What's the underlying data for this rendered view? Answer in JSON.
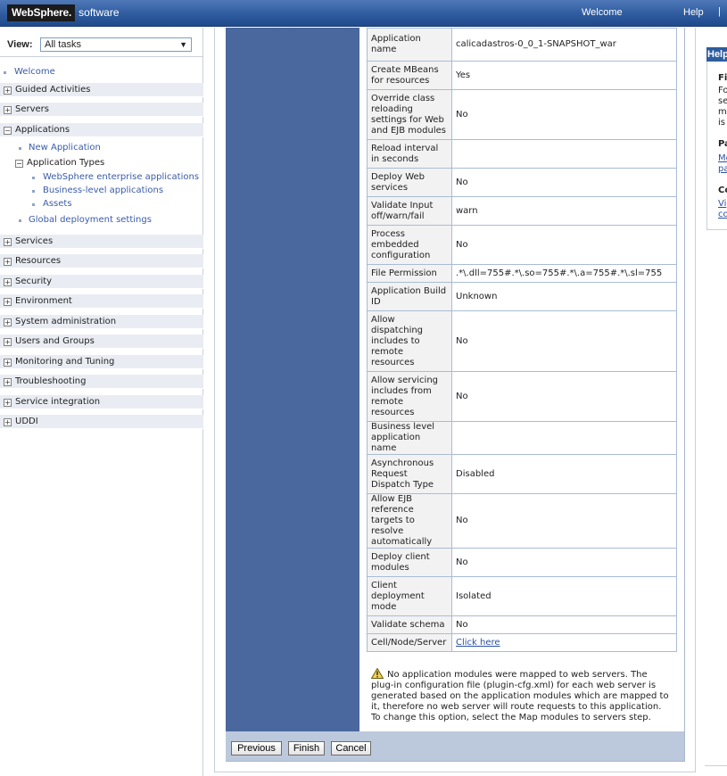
{
  "banner": {
    "brand_ws": "WebSphere.",
    "brand_sw": "software",
    "welcome": "Welcome",
    "help": "Help",
    "separator": "|"
  },
  "nav": {
    "view_label": "View:",
    "view_value": "All tasks",
    "welcome": "Welcome",
    "guided_activities": "Guided Activities",
    "servers": "Servers",
    "applications": "Applications",
    "new_application": "New Application",
    "application_types": "Application Types",
    "websphere_enterprise_applications": "WebSphere enterprise applications",
    "business_level_applications": "Business-level applications",
    "assets": "Assets",
    "global_deployment_settings": "Global deployment settings",
    "services": "Services",
    "resources": "Resources",
    "security": "Security",
    "environment": "Environment",
    "system_administration": "System administration",
    "users_and_groups": "Users and Groups",
    "monitoring_and_tuning": "Monitoring and Tuning",
    "troubleshooting": "Troubleshooting",
    "service_integration": "Service integration",
    "uddi": "UDDI"
  },
  "summary": {
    "rows": [
      {
        "k": "Application name",
        "v": "calicadastros-0_0_1-SNAPSHOT_war"
      },
      {
        "k": "Create MBeans for resources",
        "v": "Yes"
      },
      {
        "k": "Override class reloading settings for Web and EJB modules",
        "v": "No"
      },
      {
        "k": "Reload interval in seconds",
        "v": ""
      },
      {
        "k": "Deploy Web services",
        "v": "No"
      },
      {
        "k": "Validate Input off/warn/fail",
        "v": "warn"
      },
      {
        "k": "Process embedded configuration",
        "v": "No"
      },
      {
        "k": "File Permission",
        "v": ".*\\.dll=755#.*\\.so=755#.*\\.a=755#.*\\.sl=755"
      },
      {
        "k": "Application Build ID",
        "v": "Unknown"
      },
      {
        "k": "Allow dispatching includes to remote resources",
        "v": "No"
      },
      {
        "k": "Allow servicing includes from remote resources",
        "v": "No"
      },
      {
        "k": "Business level application name",
        "v": ""
      },
      {
        "k": "Asynchronous Request Dispatch Type",
        "v": "Disabled"
      },
      {
        "k": "Allow EJB reference targets to resolve automatically",
        "v": "No"
      },
      {
        "k": "Deploy client modules",
        "v": "No"
      },
      {
        "k": "Client deployment mode",
        "v": "Isolated"
      },
      {
        "k": "Validate schema",
        "v": "No"
      },
      {
        "k": "Cell/Node/Server",
        "v": "Click here"
      }
    ]
  },
  "warning": {
    "line1": "No application modules were mapped to web servers. The",
    "line2": "plug-in configuration file (plugin-cfg.xml) for each web server is",
    "line3": "generated based on the application modules which are mapped to",
    "line4": "it, therefore no web server will route requests to this application.",
    "line5": "To change this option, select the Map modules to servers step."
  },
  "buttons": {
    "previous": "Previous",
    "finish": "Finish",
    "cancel": "Cancel"
  },
  "help_panel": {
    "title": "Help",
    "f1": "Fi",
    "f2": "Fo",
    "f3": "se",
    "f4": "m",
    "f5": "is",
    "p1": "Pa",
    "p2": "Mo",
    "p3": "pa",
    "c1": "Co",
    "c2": "Vi",
    "c3": "co"
  },
  "colors": {
    "banner": "#2f5c9f",
    "steps_column": "#4a679e",
    "button_bar": "#bcc9dc",
    "nav_category": "#e9edf3",
    "link": "#3a5ca8"
  }
}
